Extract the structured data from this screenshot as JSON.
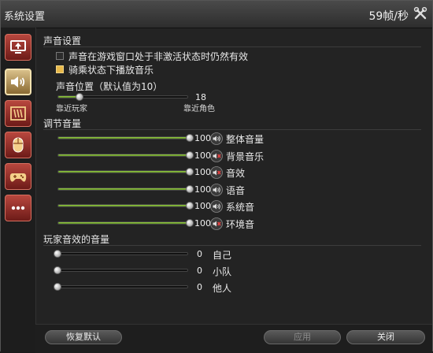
{
  "window": {
    "title": "系统设置",
    "fps": "59帧/秒"
  },
  "sidebar": {
    "tabs": [
      {
        "icon": "display-settings-icon"
      },
      {
        "icon": "speaker-icon",
        "active": true
      },
      {
        "icon": "ui-settings-icon"
      },
      {
        "icon": "mouse-icon"
      },
      {
        "icon": "gamepad-icon"
      },
      {
        "icon": "more-icon"
      }
    ]
  },
  "sound_settings": {
    "heading": "声音设置",
    "options": [
      {
        "label": "声音在游戏窗口处于非激活状态时仍然有效",
        "checked": false
      },
      {
        "label": "骑乘状态下播放音乐",
        "checked": true
      }
    ],
    "position": {
      "label": "声音位置（默认值为10）",
      "value": "18",
      "fraction": 0.17,
      "left_label": "靠近玩家",
      "right_label": "靠近角色"
    }
  },
  "volume": {
    "heading": "调节音量",
    "items": [
      {
        "label": "整体音量",
        "value": "100",
        "fraction": 1.0,
        "muted": false
      },
      {
        "label": "背景音乐",
        "value": "100",
        "fraction": 1.0,
        "muted": true
      },
      {
        "label": "音效",
        "value": "100",
        "fraction": 1.0,
        "muted": true
      },
      {
        "label": "语音",
        "value": "100",
        "fraction": 1.0,
        "muted": false
      },
      {
        "label": "系统音",
        "value": "100",
        "fraction": 1.0,
        "muted": false
      },
      {
        "label": "环境音",
        "value": "100",
        "fraction": 1.0,
        "muted": true
      }
    ]
  },
  "player_sfx": {
    "heading": "玩家音效的音量",
    "items": [
      {
        "label": "自己",
        "value": "0",
        "fraction": 0
      },
      {
        "label": "小队",
        "value": "0",
        "fraction": 0
      },
      {
        "label": "他人",
        "value": "0",
        "fraction": 0
      }
    ]
  },
  "buttons": {
    "reset": "恢复默认",
    "apply": "应用",
    "close": "关闭"
  },
  "colors": {
    "slider_fill": "#7fb535",
    "checkbox_on": "#e8b94a",
    "tab": "#a33a32",
    "tab_active": "#c9a968"
  }
}
